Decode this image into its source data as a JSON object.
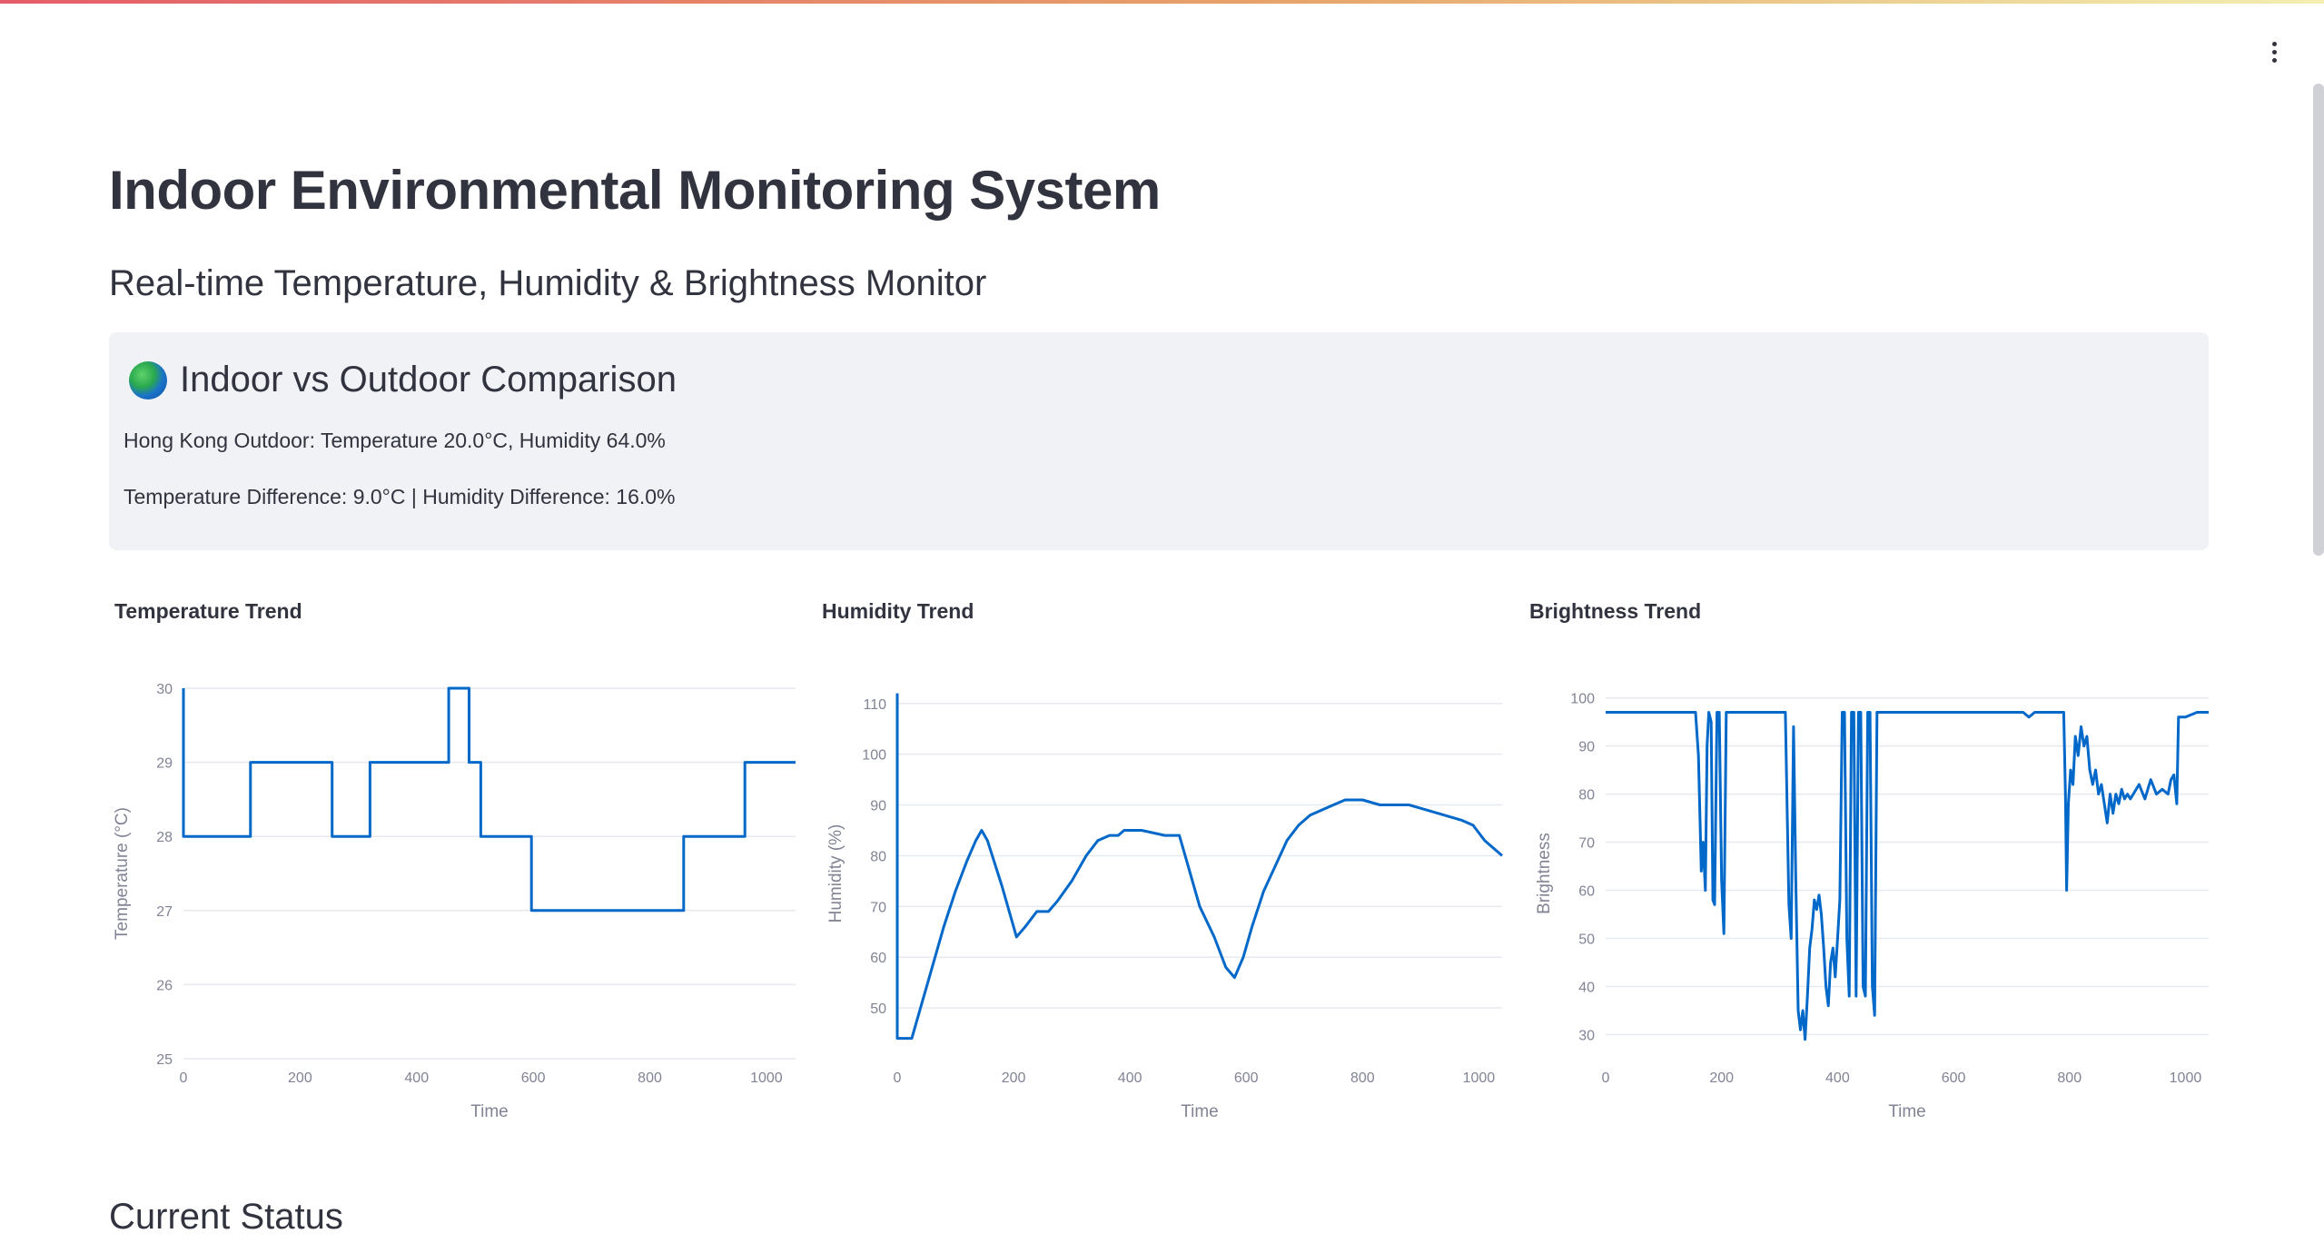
{
  "page": {
    "title": "Indoor Environmental Monitoring System",
    "subtitle": "Real-time Temperature, Humidity & Brightness Monitor",
    "current_status_heading": "Current Status"
  },
  "comparison": {
    "icon": "globe-icon",
    "title": "Indoor vs Outdoor Comparison",
    "outdoor_line": "Hong Kong Outdoor: Temperature 20.0°C, Humidity 64.0%",
    "difference_line": "Temperature Difference: 9.0°C | Humidity Difference: 16.0%"
  },
  "colors": {
    "line": "#0068c9",
    "grid": "#e6e9ef",
    "axis_text": "#808495",
    "panel": "#f0f2f6"
  },
  "chart_data": [
    {
      "type": "line",
      "title": "Temperature Trend",
      "xlabel": "Time",
      "ylabel": "Temperature (°C)",
      "xlim": [
        0,
        1050
      ],
      "ylim": [
        25,
        30
      ],
      "xticks": [
        0,
        200,
        400,
        600,
        800,
        1000
      ],
      "yticks": [
        25,
        26,
        27,
        28,
        29,
        30
      ],
      "grid": true,
      "points": [
        [
          0,
          30
        ],
        [
          0,
          28
        ],
        [
          115,
          28
        ],
        [
          115,
          29
        ],
        [
          255,
          29
        ],
        [
          255,
          28
        ],
        [
          320,
          28
        ],
        [
          320,
          29
        ],
        [
          455,
          29
        ],
        [
          455,
          30
        ],
        [
          490,
          30
        ],
        [
          490,
          29
        ],
        [
          510,
          29
        ],
        [
          510,
          28
        ],
        [
          597,
          28
        ],
        [
          597,
          27
        ],
        [
          858,
          27
        ],
        [
          858,
          28
        ],
        [
          963,
          28
        ],
        [
          963,
          29
        ],
        [
          1050,
          29
        ]
      ]
    },
    {
      "type": "line",
      "title": "Humidity Trend",
      "xlabel": "Time",
      "ylabel": "Humidity (%)",
      "xlim": [
        0,
        1040
      ],
      "ylim": [
        40,
        113
      ],
      "xticks": [
        0,
        200,
        400,
        600,
        800,
        1000
      ],
      "yticks": [
        50,
        60,
        70,
        80,
        90,
        100,
        110
      ],
      "grid": true,
      "points": [
        [
          0,
          112
        ],
        [
          0,
          44
        ],
        [
          25,
          44
        ],
        [
          40,
          50
        ],
        [
          60,
          58
        ],
        [
          80,
          66
        ],
        [
          100,
          73
        ],
        [
          120,
          79
        ],
        [
          135,
          83
        ],
        [
          145,
          85
        ],
        [
          155,
          83
        ],
        [
          180,
          74
        ],
        [
          205,
          64
        ],
        [
          220,
          66
        ],
        [
          240,
          69
        ],
        [
          260,
          69
        ],
        [
          275,
          71
        ],
        [
          300,
          75
        ],
        [
          325,
          80
        ],
        [
          345,
          83
        ],
        [
          365,
          84
        ],
        [
          380,
          84
        ],
        [
          390,
          85
        ],
        [
          420,
          85
        ],
        [
          460,
          84
        ],
        [
          485,
          84
        ],
        [
          500,
          78
        ],
        [
          520,
          70
        ],
        [
          545,
          64
        ],
        [
          565,
          58
        ],
        [
          580,
          56
        ],
        [
          595,
          60
        ],
        [
          610,
          66
        ],
        [
          630,
          73
        ],
        [
          650,
          78
        ],
        [
          670,
          83
        ],
        [
          690,
          86
        ],
        [
          710,
          88
        ],
        [
          730,
          89
        ],
        [
          750,
          90
        ],
        [
          770,
          91
        ],
        [
          800,
          91
        ],
        [
          830,
          90
        ],
        [
          880,
          90
        ],
        [
          910,
          89
        ],
        [
          940,
          88
        ],
        [
          970,
          87
        ],
        [
          990,
          86
        ],
        [
          1010,
          83
        ],
        [
          1040,
          80
        ]
      ]
    },
    {
      "type": "line",
      "title": "Brightness Trend",
      "xlabel": "Time",
      "ylabel": "Brightness",
      "xlim": [
        0,
        1040
      ],
      "ylim": [
        25,
        102
      ],
      "xticks": [
        0,
        200,
        400,
        600,
        800,
        1000
      ],
      "yticks": [
        30,
        40,
        50,
        60,
        70,
        80,
        90,
        100
      ],
      "grid": true,
      "points": [
        [
          0,
          97
        ],
        [
          155,
          97
        ],
        [
          160,
          88
        ],
        [
          165,
          64
        ],
        [
          168,
          70
        ],
        [
          172,
          60
        ],
        [
          175,
          90
        ],
        [
          178,
          97
        ],
        [
          182,
          95
        ],
        [
          185,
          58
        ],
        [
          188,
          57
        ],
        [
          192,
          97
        ],
        [
          196,
          97
        ],
        [
          200,
          62
        ],
        [
          204,
          51
        ],
        [
          208,
          97
        ],
        [
          310,
          97
        ],
        [
          316,
          57
        ],
        [
          320,
          50
        ],
        [
          324,
          94
        ],
        [
          328,
          62
        ],
        [
          332,
          35
        ],
        [
          336,
          31
        ],
        [
          340,
          35
        ],
        [
          344,
          29
        ],
        [
          348,
          38
        ],
        [
          352,
          48
        ],
        [
          356,
          52
        ],
        [
          360,
          58
        ],
        [
          364,
          56
        ],
        [
          368,
          59
        ],
        [
          372,
          55
        ],
        [
          376,
          48
        ],
        [
          380,
          40
        ],
        [
          384,
          36
        ],
        [
          388,
          45
        ],
        [
          392,
          48
        ],
        [
          396,
          42
        ],
        [
          400,
          50
        ],
        [
          404,
          58
        ],
        [
          408,
          97
        ],
        [
          412,
          97
        ],
        [
          416,
          50
        ],
        [
          420,
          38
        ],
        [
          424,
          97
        ],
        [
          428,
          97
        ],
        [
          432,
          38
        ],
        [
          436,
          97
        ],
        [
          440,
          97
        ],
        [
          444,
          40
        ],
        [
          448,
          38
        ],
        [
          452,
          97
        ],
        [
          456,
          97
        ],
        [
          460,
          40
        ],
        [
          464,
          34
        ],
        [
          468,
          97
        ],
        [
          720,
          97
        ],
        [
          730,
          96
        ],
        [
          740,
          97
        ],
        [
          760,
          97
        ],
        [
          790,
          97
        ],
        [
          793,
          80
        ],
        [
          795,
          60
        ],
        [
          798,
          78
        ],
        [
          802,
          85
        ],
        [
          806,
          82
        ],
        [
          810,
          92
        ],
        [
          815,
          88
        ],
        [
          820,
          94
        ],
        [
          825,
          90
        ],
        [
          830,
          92
        ],
        [
          835,
          85
        ],
        [
          840,
          82
        ],
        [
          845,
          85
        ],
        [
          850,
          80
        ],
        [
          855,
          82
        ],
        [
          860,
          78
        ],
        [
          865,
          74
        ],
        [
          870,
          80
        ],
        [
          875,
          76
        ],
        [
          880,
          80
        ],
        [
          885,
          78
        ],
        [
          890,
          81
        ],
        [
          895,
          79
        ],
        [
          900,
          80
        ],
        [
          905,
          79
        ],
        [
          910,
          80
        ],
        [
          920,
          82
        ],
        [
          930,
          79
        ],
        [
          940,
          83
        ],
        [
          950,
          80
        ],
        [
          960,
          81
        ],
        [
          970,
          80
        ],
        [
          975,
          83
        ],
        [
          980,
          84
        ],
        [
          985,
          78
        ],
        [
          988,
          96
        ],
        [
          1000,
          96
        ],
        [
          1020,
          97
        ],
        [
          1040,
          97
        ]
      ]
    }
  ]
}
